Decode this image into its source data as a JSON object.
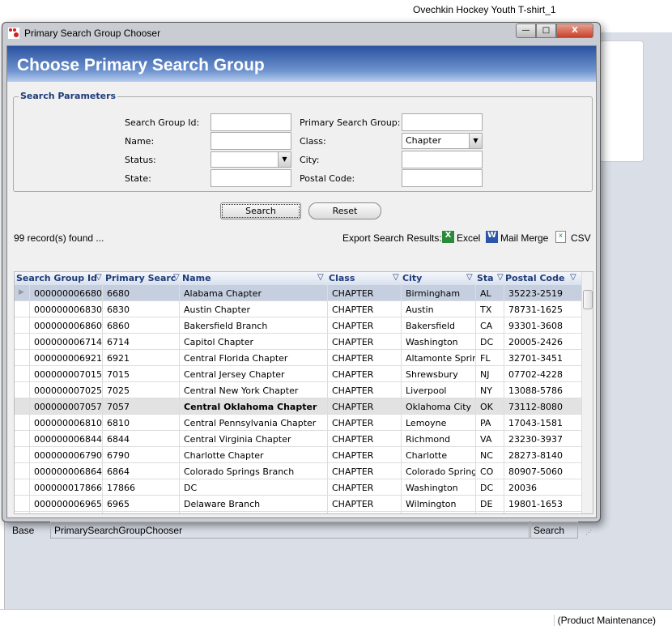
{
  "background": {
    "product_title": "Ovechkin Hockey Youth T-shirt_1",
    "status_text": "(Product Maintenance)"
  },
  "dialog": {
    "title": "Primary Search Group Chooser",
    "window_buttons": {
      "minimize": "—",
      "maximize": "□",
      "close": "X"
    },
    "banner": "Choose Primary Search Group",
    "params": {
      "legend": "Search Parameters",
      "fields": [
        {
          "label": "Search Group Id:",
          "value": ""
        },
        {
          "label": "Name:",
          "value": ""
        },
        {
          "label": "Status:",
          "value": ""
        },
        {
          "label": "State:",
          "value": ""
        },
        {
          "label": "Primary Search Group:",
          "value": ""
        },
        {
          "label": "Class:",
          "value": "Chapter"
        },
        {
          "label": "City:",
          "value": ""
        },
        {
          "label": "Postal Code:",
          "value": ""
        }
      ]
    },
    "search_label": "Search",
    "reset_label": "Reset",
    "records_found": "99 record(s) found ...",
    "export": {
      "label": "Export Search Results:",
      "excel": "Excel",
      "mail_merge": "Mail Merge",
      "csv": "CSV"
    },
    "grid": {
      "columns": [
        "Search Group Id",
        "Primary Searc",
        "Name",
        "Class",
        "City",
        "Sta",
        "Postal Code"
      ],
      "rows": [
        [
          "000000006680",
          "6680",
          "Alabama Chapter",
          "CHAPTER",
          "Birmingham",
          "AL",
          "35223-2519"
        ],
        [
          "000000006830",
          "6830",
          "Austin Chapter",
          "CHAPTER",
          "Austin",
          "TX",
          "78731-1625"
        ],
        [
          "000000006860",
          "6860",
          "Bakersfield Branch",
          "CHAPTER",
          "Bakersfield",
          "CA",
          "93301-3608"
        ],
        [
          "000000006714",
          "6714",
          "Capitol Chapter",
          "CHAPTER",
          "Washington",
          "DC",
          "20005-2426"
        ],
        [
          "000000006921",
          "6921",
          "Central Florida Chapter",
          "CHAPTER",
          "Altamonte Sprin",
          "FL",
          "32701-3451"
        ],
        [
          "000000007015",
          "7015",
          "Central Jersey Chapter",
          "CHAPTER",
          "Shrewsbury",
          "NJ",
          "07702-4228"
        ],
        [
          "000000007025",
          "7025",
          "Central New York Chapter",
          "CHAPTER",
          "Liverpool",
          "NY",
          "13088-5786"
        ],
        [
          "000000007057",
          "7057",
          "Central Oklahoma Chapter",
          "CHAPTER",
          "Oklahoma City",
          "OK",
          "73112-8080"
        ],
        [
          "000000006810",
          "6810",
          "Central Pennsylvania Chapter",
          "CHAPTER",
          "Lemoyne",
          "PA",
          "17043-1581"
        ],
        [
          "000000006844",
          "6844",
          "Central Virginia Chapter",
          "CHAPTER",
          "Richmond",
          "VA",
          "23230-3937"
        ],
        [
          "000000006790",
          "6790",
          "Charlotte Chapter",
          "CHAPTER",
          "Charlotte",
          "NC",
          "28273-8140"
        ],
        [
          "000000006864",
          "6864",
          "Colorado Springs Branch",
          "CHAPTER",
          "Colorado Springs",
          "CO",
          "80907-5060"
        ],
        [
          "000000017866",
          "17866",
          "DC",
          "CHAPTER",
          "Washington",
          "DC",
          "20036"
        ],
        [
          "000000006965",
          "6965",
          "Delaware Branch",
          "CHAPTER",
          "Wilmington",
          "DE",
          "19801-1653"
        ]
      ]
    },
    "footer": {
      "base": "Base",
      "form_name": "PrimarySearchGroupChooser",
      "mode": "Search"
    }
  }
}
